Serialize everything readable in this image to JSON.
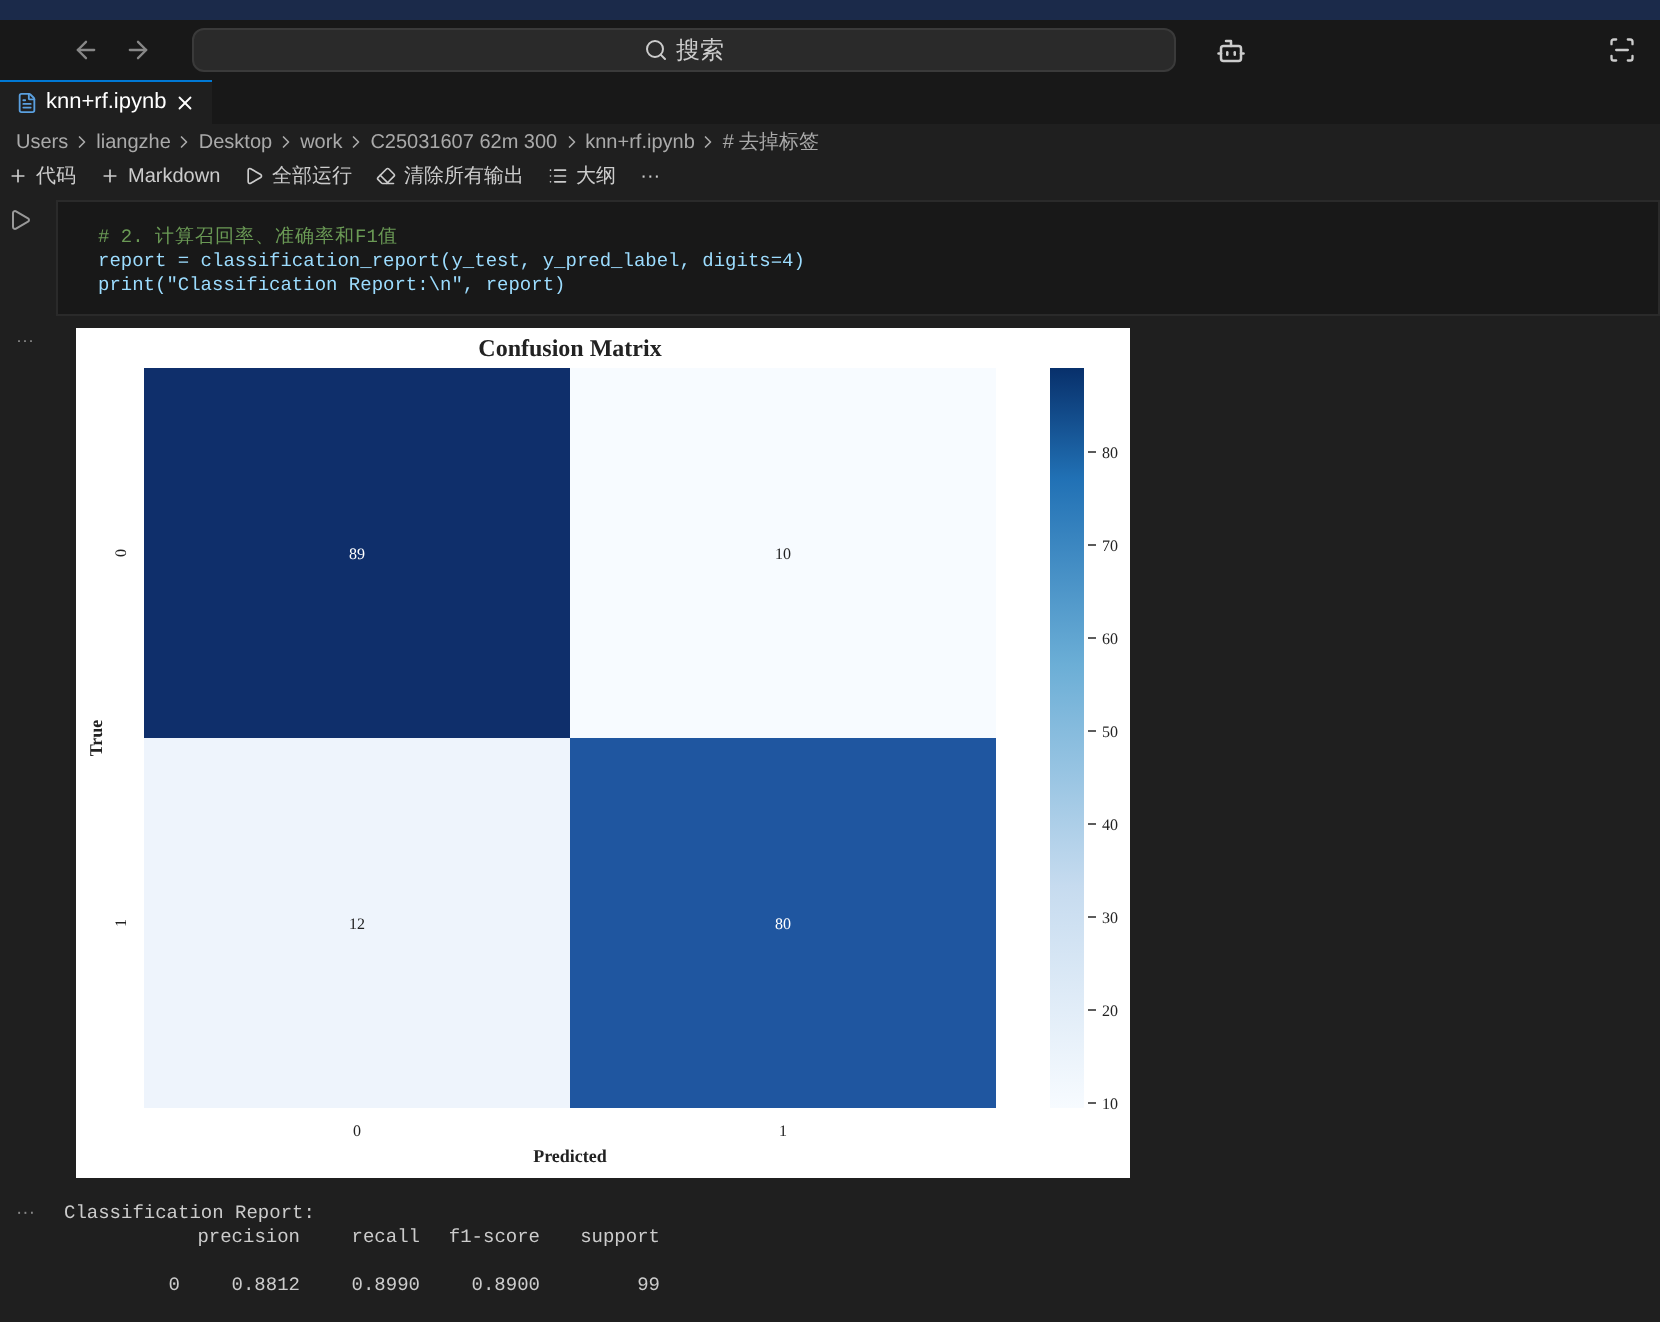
{
  "title_bar": {
    "search": "搜索"
  },
  "tabs": [
    {
      "label": "knn+rf.ipynb",
      "selected": true
    }
  ],
  "breadcrumb": [
    "Users",
    "liangzhe",
    "Desktop",
    "work",
    "C25031607 62m 300",
    "knn+rf.ipynb",
    "# 去掉标签"
  ],
  "toolbar": [
    "代码",
    "Markdown",
    "全部运行",
    "清除所有输出",
    "大纲",
    "···"
  ],
  "code_cell": {
    "lines": [
      {
        "kind": "comment",
        "text": "# 2. 计算召回率、准确率和F1值"
      },
      {
        "kind": "code",
        "text": "report = classification_report(y_test, y_pred_label, digits=4)"
      },
      {
        "kind": "code",
        "text": "print(\"Classification Report:\\n\", report)"
      }
    ]
  },
  "figure": {
    "title": "Confusion Matrix",
    "xlabel": "Predicted",
    "ylabel": "True",
    "xticks": [
      "0",
      "1"
    ],
    "yticks": [
      "0",
      "1"
    ],
    "cells": [
      {
        "value": "89",
        "color": "#0f2f6b"
      },
      {
        "value": "10",
        "color": "#f7fbff"
      },
      {
        "value": "12",
        "color": "#eef4fc"
      },
      {
        "value": "80",
        "color": "#1f56a0"
      }
    ],
    "colorbar_ticks": [
      "80",
      "70",
      "60",
      "50",
      "40",
      "30",
      "20",
      "10"
    ]
  },
  "output_marks": [
    "···",
    "···"
  ],
  "report": {
    "heading": "Classification Report:",
    "columns": [
      "",
      "precision",
      "recall",
      "f1-score",
      "support"
    ],
    "rows": [
      [
        "0",
        "0.8812",
        "0.8990",
        "0.8900",
        "99"
      ]
    ]
  }
}
